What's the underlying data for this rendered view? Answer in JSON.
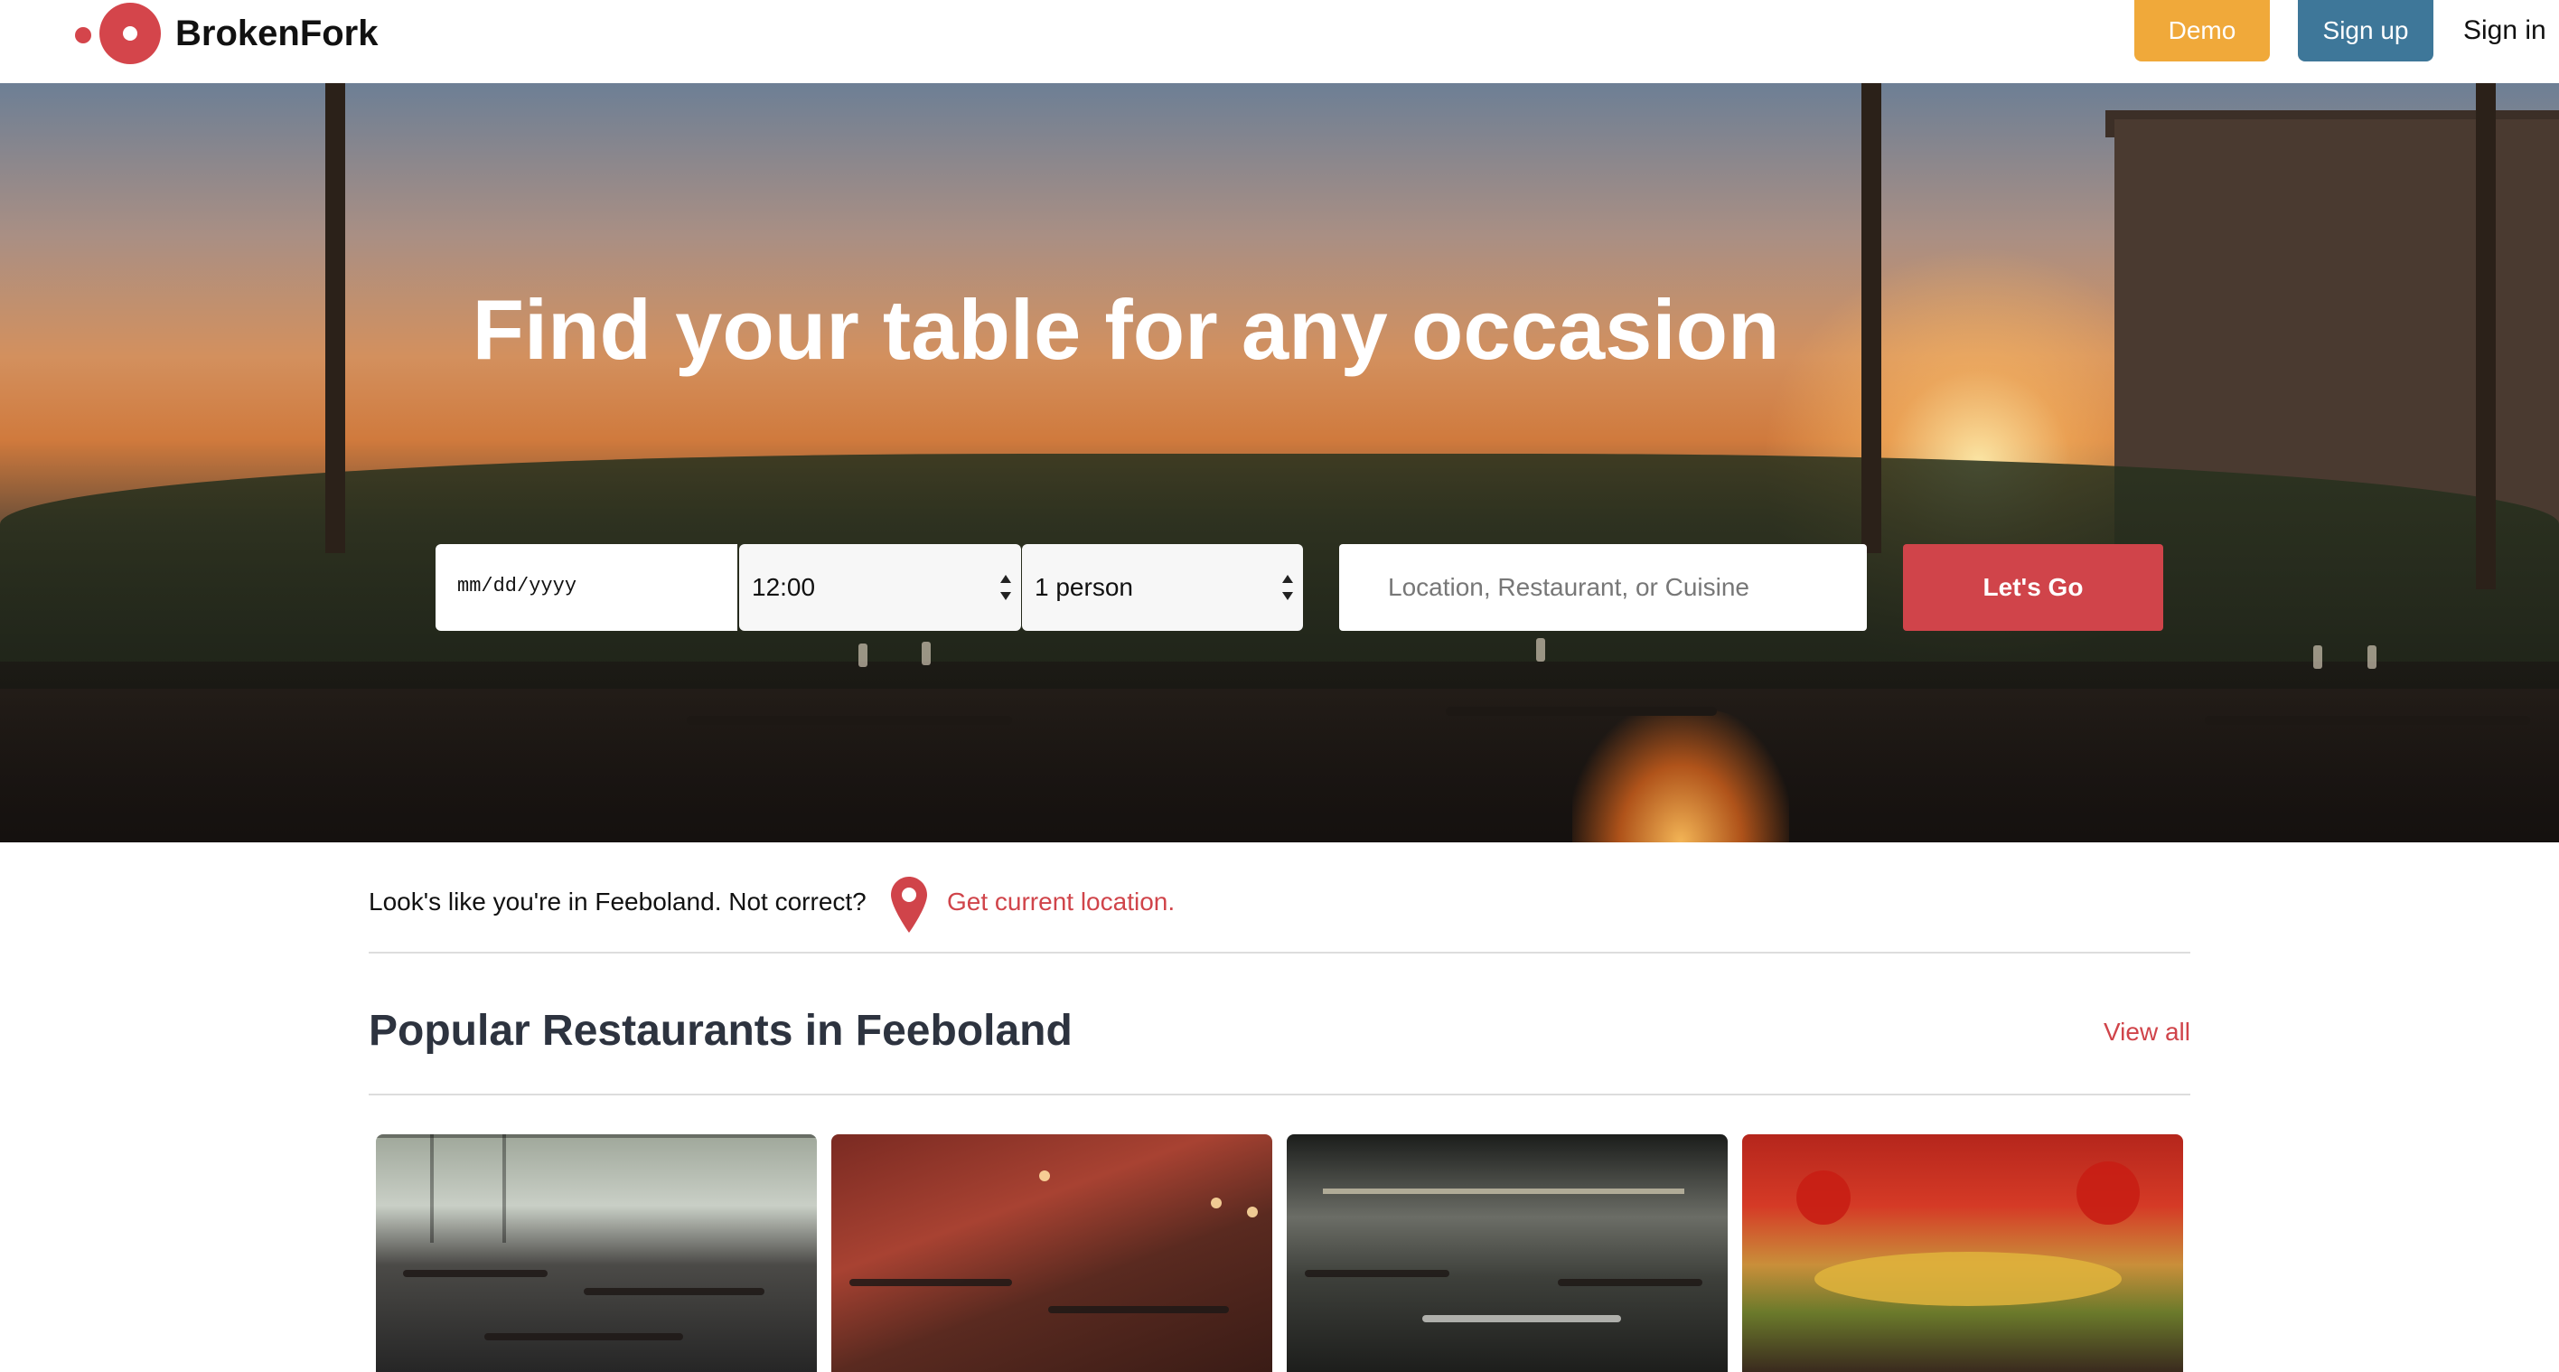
{
  "header": {
    "brand": "BrokenFork",
    "demo_label": "Demo",
    "signup_label": "Sign up",
    "signin_label": "Sign in"
  },
  "hero": {
    "title": "Find your table for any occasion",
    "date_placeholder": "mm/dd/yyyy",
    "time_value": "12:00",
    "party_value": "1 person",
    "search_placeholder": "Location, Restaurant, or Cuisine",
    "submit_label": "Let's Go"
  },
  "location": {
    "message": "Look's like you're in Feeboland. Not correct?",
    "link": "Get current location."
  },
  "popular": {
    "title": "Popular Restaurants in Feeboland",
    "view_all": "View all"
  },
  "colors": {
    "brand_red": "#d0444a",
    "demo_orange": "#f0a93a",
    "signup_blue": "#3e7799",
    "heading_dark": "#2d333f"
  },
  "icons": {
    "logo": "logo-icon",
    "location_pin": "location-pin-icon",
    "select_arrows": "select-arrows-icon"
  }
}
